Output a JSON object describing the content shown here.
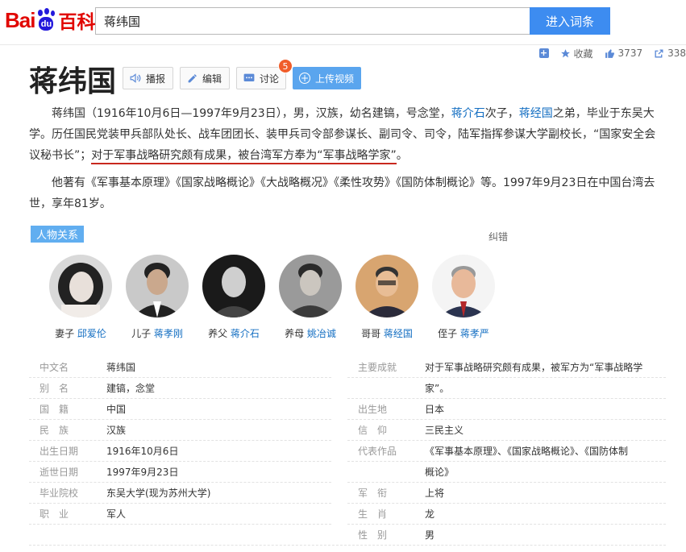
{
  "header": {
    "logo_bai": "Bai",
    "logo_du": "du",
    "logo_baike": "百科",
    "search_value": "蒋纬国",
    "search_button": "进入词条"
  },
  "stats": {
    "collect_label": "收藏",
    "like_count": "3737",
    "share_count": "338"
  },
  "title": "蒋纬国",
  "title_buttons": {
    "play": "播报",
    "edit": "编辑",
    "discuss": "讨论",
    "discuss_badge": "5",
    "upload": "上传视频"
  },
  "summary": {
    "p1_a": "蒋纬国（1916年10月6日—1997年9月23日），男，汉族，幼名建镐，号念堂，",
    "p1_link1": "蒋介石",
    "p1_b": "次子，",
    "p1_link2": "蒋经国",
    "p1_c": "之弟，毕业于东吴大学。历任国民党装甲兵部队处长、战车团团长、装甲兵司令部参谋长、副司令、司令，陆军指挥参谋大学副校长，“国家安全会议秘书长”；",
    "p1_hl": "对于军事战略研究颇有成果，被台湾军方奉为“军事战略学家”",
    "p1_end": "。",
    "p2": "他著有《军事基本原理》《国家战略概论》《大战略概况》《柔性攻势》《国防体制概论》等。1997年9月23日在中国台湾去世，享年81岁。"
  },
  "relations": {
    "tag": "人物关系",
    "report": "纠错",
    "people": [
      {
        "relation": "妻子",
        "name": "邱爱伦"
      },
      {
        "relation": "儿子",
        "name": "蒋孝刚"
      },
      {
        "relation": "养父",
        "name": "蒋介石"
      },
      {
        "relation": "养母",
        "name": "姚冶诚"
      },
      {
        "relation": "哥哥",
        "name": "蒋经国"
      },
      {
        "relation": "侄子",
        "name": "蒋孝严"
      }
    ]
  },
  "info": {
    "left": [
      {
        "k": "中文名",
        "v": "蒋纬国"
      },
      {
        "k": "别　名",
        "v": "建镐，念堂"
      },
      {
        "k": "国　籍",
        "v": "中国"
      },
      {
        "k": "民　族",
        "v": "汉族"
      },
      {
        "k": "出生日期",
        "v": "1916年10月6日"
      },
      {
        "k": "逝世日期",
        "v": "1997年9月23日"
      },
      {
        "k": "毕业院校",
        "v": "东吴大学",
        "v2": "(现为苏州大学)"
      },
      {
        "k": "职　业",
        "v": "军人"
      }
    ],
    "right": [
      {
        "k": "主要成就",
        "v": "对于军事战略研究颇有成果，被军方为“军事战略学",
        "v_line2": "家”。"
      },
      {
        "k": "出生地",
        "v": "日本"
      },
      {
        "k": "信　仰",
        "v": "三民主义"
      },
      {
        "k": "代表作品",
        "v": "《军事基本原理》、《国家战略概论》、《国防体制",
        "v_line2": "概论》"
      },
      {
        "k": "军　衔",
        "v": "上将"
      },
      {
        "k": "生　肖",
        "v": "龙"
      },
      {
        "k": "性　别",
        "v": "男"
      }
    ]
  },
  "colors": {
    "link": "#136ec2",
    "search_button": "#3d8cf0",
    "highlight_underline": "#c8281e",
    "tag_bg": "#61aef0",
    "badge": "#f05d2a"
  }
}
